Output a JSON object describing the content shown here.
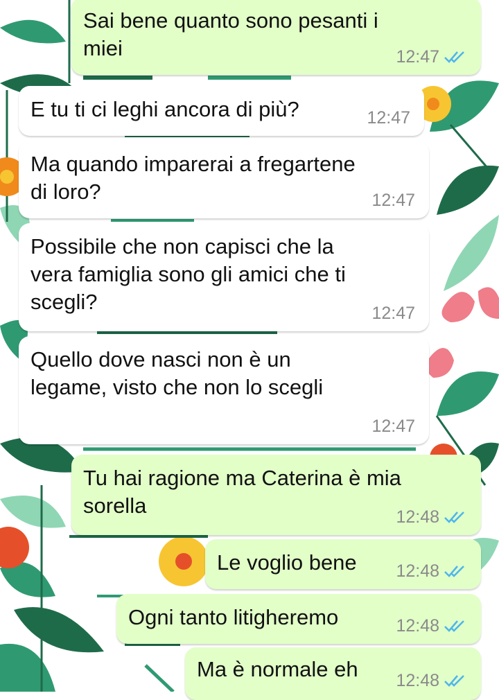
{
  "chat": {
    "messages": [
      {
        "direction": "outgoing",
        "lines": [
          "Sai bene quanto sono pesanti i",
          "miei"
        ],
        "time": "12:47",
        "status": "read"
      },
      {
        "direction": "incoming",
        "lines": [
          "E tu ti ci leghi ancora di più?"
        ],
        "time": "12:47"
      },
      {
        "direction": "incoming",
        "lines": [
          "Ma quando imparerai a fregartene",
          "di loro?"
        ],
        "time": "12:47"
      },
      {
        "direction": "incoming",
        "lines": [
          "Possibile che non capisci che la",
          "vera famiglia sono gli amici che ti",
          "scegli?"
        ],
        "time": "12:47"
      },
      {
        "direction": "incoming",
        "lines": [
          "Quello dove nasci non è un",
          "legame, visto che non lo scegli"
        ],
        "time": "12:47"
      },
      {
        "direction": "outgoing",
        "lines": [
          "Tu hai ragione ma Caterina è mia",
          "sorella"
        ],
        "time": "12:48",
        "status": "read"
      },
      {
        "direction": "outgoing",
        "lines": [
          "Le voglio bene"
        ],
        "time": "12:48",
        "status": "read"
      },
      {
        "direction": "outgoing",
        "lines": [
          "Ogni tanto litigheremo"
        ],
        "time": "12:48",
        "status": "read"
      },
      {
        "direction": "outgoing",
        "lines": [
          "Ma è normale eh"
        ],
        "time": "12:48",
        "status": "read"
      }
    ]
  },
  "theme": {
    "outgoing_bubble": "#e2ffc8",
    "incoming_bubble": "#ffffff",
    "read_tick": "#4fb6ec",
    "time_text": "#8a8a8a",
    "wallpaper_leaf_dark": "#1e6b4a",
    "wallpaper_leaf_mid": "#2f9a72",
    "wallpaper_leaf_light": "#8fd6b5",
    "wallpaper_flower_orange": "#f08a1c",
    "wallpaper_flower_yellow": "#f7c531",
    "wallpaper_flower_pink": "#ef7d8a",
    "wallpaper_flower_red": "#e5502a"
  },
  "icons": {
    "read_receipt": "double-check-icon"
  }
}
